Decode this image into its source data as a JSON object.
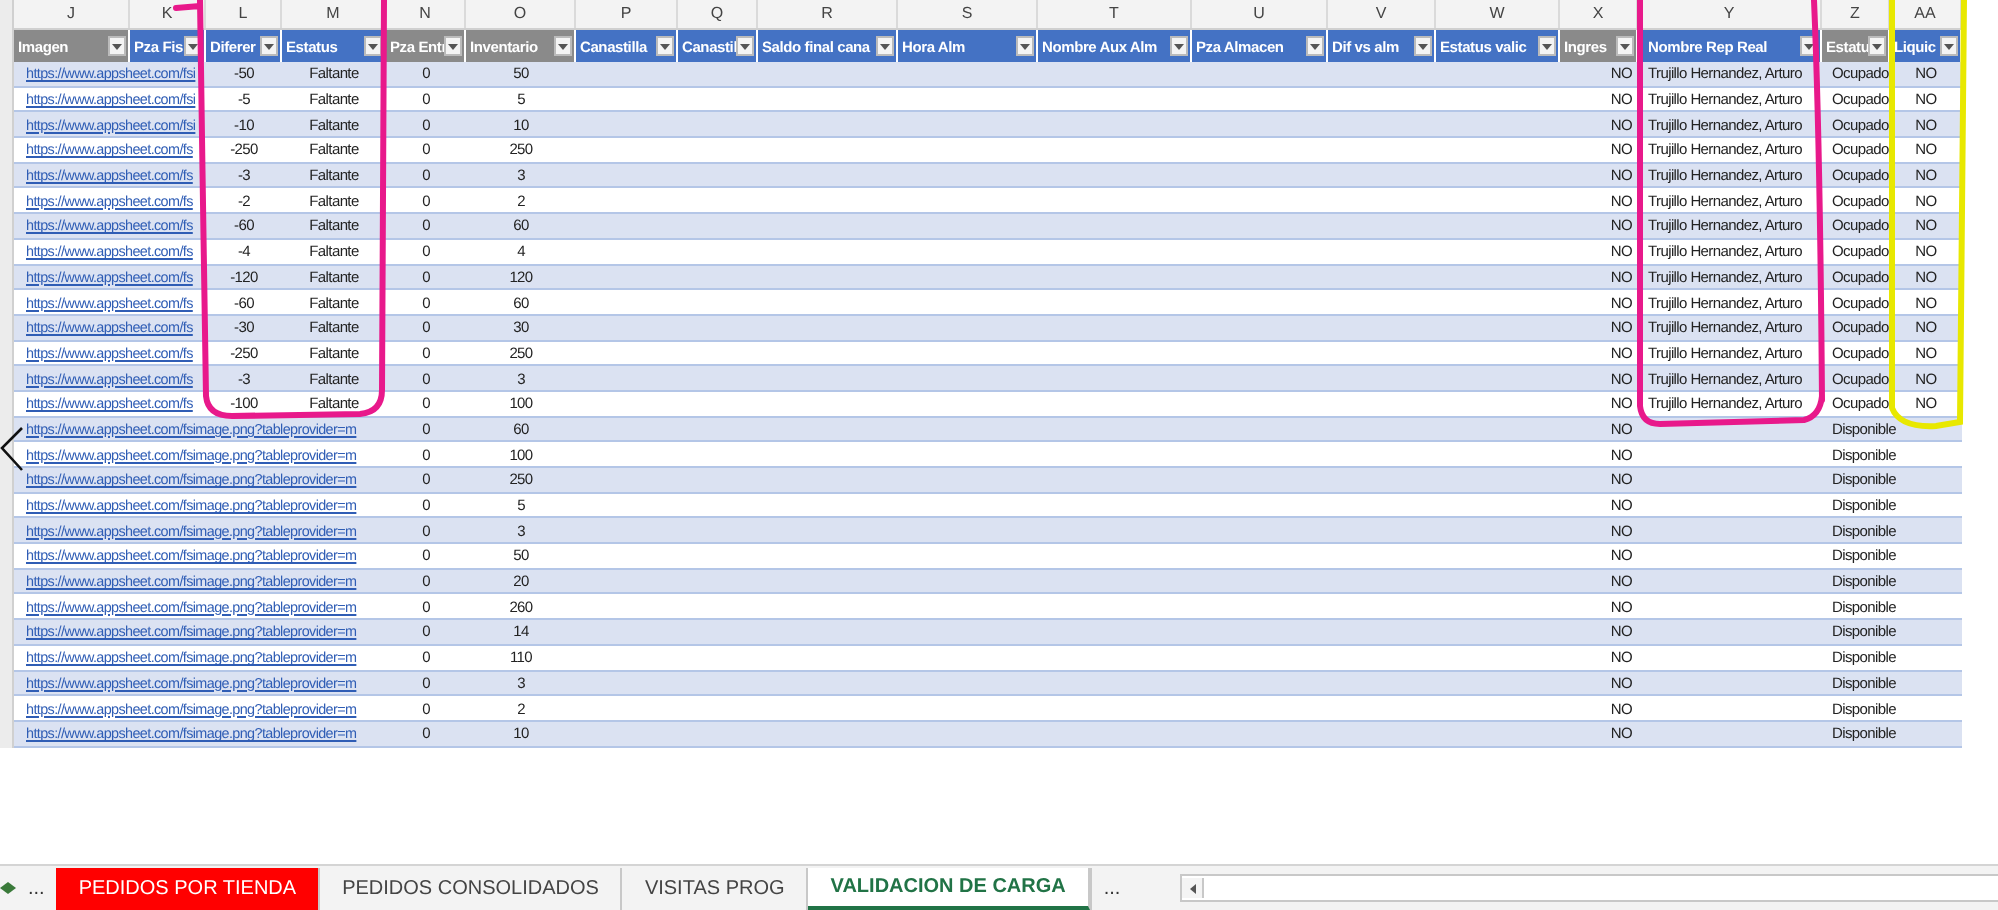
{
  "columns": [
    {
      "letter": "J",
      "header": "Imagen",
      "shaded": true,
      "kind": "link"
    },
    {
      "letter": "K",
      "header": "Pza Fis",
      "shaded": false
    },
    {
      "letter": "L",
      "header": "Diferer",
      "shaded": false,
      "kind": "centered"
    },
    {
      "letter": "M",
      "header": "Estatus",
      "shaded": false,
      "kind": "centered"
    },
    {
      "letter": "N",
      "header": "Pza Entr",
      "shaded": true,
      "kind": "centered"
    },
    {
      "letter": "O",
      "header": "Inventario",
      "shaded": true,
      "kind": "centered"
    },
    {
      "letter": "P",
      "header": "Canastilla",
      "shaded": false
    },
    {
      "letter": "Q",
      "header": "Canastil",
      "shaded": false
    },
    {
      "letter": "R",
      "header": "Saldo final cana",
      "shaded": false
    },
    {
      "letter": "S",
      "header": "Hora Alm",
      "shaded": false
    },
    {
      "letter": "T",
      "header": "Nombre Aux Alm",
      "shaded": false
    },
    {
      "letter": "U",
      "header": "Pza Almacen",
      "shaded": false
    },
    {
      "letter": "V",
      "header": "Dif vs alm",
      "shaded": false
    },
    {
      "letter": "W",
      "header": "Estatus valic",
      "shaded": false
    },
    {
      "letter": "X",
      "header": "Ingres",
      "shaded": true,
      "kind": "right"
    },
    {
      "letter": "Y",
      "header": "Nombre Rep Real",
      "shaded": false,
      "kind": "left"
    },
    {
      "letter": "Z",
      "header": "Estatu",
      "shaded": true,
      "kind": "left"
    },
    {
      "letter": "AA",
      "header": "Liquic",
      "shaded": false,
      "kind": "centered"
    }
  ],
  "rows": [
    {
      "j": "https://www.appsheet.com/fsi",
      "l": "-50",
      "m": "Faltante",
      "n": "0",
      "o": "50",
      "x": "NO",
      "y": "Trujillo Hernandez, Arturo",
      "z": "Ocupado",
      "aa": "NO"
    },
    {
      "j": "https://www.appsheet.com/fsi",
      "l": "-5",
      "m": "Faltante",
      "n": "0",
      "o": "5",
      "x": "NO",
      "y": "Trujillo Hernandez, Arturo",
      "z": "Ocupado",
      "aa": "NO"
    },
    {
      "j": "https://www.appsheet.com/fsi",
      "l": "-10",
      "m": "Faltante",
      "n": "0",
      "o": "10",
      "x": "NO",
      "y": "Trujillo Hernandez, Arturo",
      "z": "Ocupado",
      "aa": "NO"
    },
    {
      "j": "https://www.appsheet.com/fs",
      "l": "-250",
      "m": "Faltante",
      "n": "0",
      "o": "250",
      "x": "NO",
      "y": "Trujillo Hernandez, Arturo",
      "z": "Ocupado",
      "aa": "NO"
    },
    {
      "j": "https://www.appsheet.com/fs",
      "l": "-3",
      "m": "Faltante",
      "n": "0",
      "o": "3",
      "x": "NO",
      "y": "Trujillo Hernandez, Arturo",
      "z": "Ocupado",
      "aa": "NO"
    },
    {
      "j": "https://www.appsheet.com/fs",
      "l": "-2",
      "m": "Faltante",
      "n": "0",
      "o": "2",
      "x": "NO",
      "y": "Trujillo Hernandez, Arturo",
      "z": "Ocupado",
      "aa": "NO"
    },
    {
      "j": "https://www.appsheet.com/fs",
      "l": "-60",
      "m": "Faltante",
      "n": "0",
      "o": "60",
      "x": "NO",
      "y": "Trujillo Hernandez, Arturo",
      "z": "Ocupado",
      "aa": "NO"
    },
    {
      "j": "https://www.appsheet.com/fs",
      "l": "-4",
      "m": "Faltante",
      "n": "0",
      "o": "4",
      "x": "NO",
      "y": "Trujillo Hernandez, Arturo",
      "z": "Ocupado",
      "aa": "NO"
    },
    {
      "j": "https://www.appsheet.com/fs",
      "l": "-120",
      "m": "Faltante",
      "n": "0",
      "o": "120",
      "x": "NO",
      "y": "Trujillo Hernandez, Arturo",
      "z": "Ocupado",
      "aa": "NO"
    },
    {
      "j": "https://www.appsheet.com/fs",
      "l": "-60",
      "m": "Faltante",
      "n": "0",
      "o": "60",
      "x": "NO",
      "y": "Trujillo Hernandez, Arturo",
      "z": "Ocupado",
      "aa": "NO"
    },
    {
      "j": "https://www.appsheet.com/fs",
      "l": "-30",
      "m": "Faltante",
      "n": "0",
      "o": "30",
      "x": "NO",
      "y": "Trujillo Hernandez, Arturo",
      "z": "Ocupado",
      "aa": "NO"
    },
    {
      "j": "https://www.appsheet.com/fs",
      "l": "-250",
      "m": "Faltante",
      "n": "0",
      "o": "250",
      "x": "NO",
      "y": "Trujillo Hernandez, Arturo",
      "z": "Ocupado",
      "aa": "NO"
    },
    {
      "j": "https://www.appsheet.com/fs",
      "l": "-3",
      "m": "Faltante",
      "n": "0",
      "o": "3",
      "x": "NO",
      "y": "Trujillo Hernandez, Arturo",
      "z": "Ocupado",
      "aa": "NO"
    },
    {
      "j": "https://www.appsheet.com/fs",
      "l": "-100",
      "m": "Faltante",
      "n": "0",
      "o": "100",
      "x": "NO",
      "y": "Trujillo Hernandez, Arturo",
      "z": "Ocupado",
      "aa": "NO"
    },
    {
      "j": "https://www.appsheet.com/fsimage.png?tableprovider=m",
      "n": "0",
      "o": "60",
      "x": "NO",
      "z": "Disponible"
    },
    {
      "j": "https://www.appsheet.com/fsimage.png?tableprovider=m",
      "n": "0",
      "o": "100",
      "x": "NO",
      "z": "Disponible"
    },
    {
      "j": "https://www.appsheet.com/fsimage.png?tableprovider=m",
      "n": "0",
      "o": "250",
      "x": "NO",
      "z": "Disponible"
    },
    {
      "j": "https://www.appsheet.com/fsimage.png?tableprovider=m",
      "n": "0",
      "o": "5",
      "x": "NO",
      "z": "Disponible"
    },
    {
      "j": "https://www.appsheet.com/fsimage.png?tableprovider=m",
      "n": "0",
      "o": "3",
      "x": "NO",
      "z": "Disponible"
    },
    {
      "j": "https://www.appsheet.com/fsimage.png?tableprovider=m",
      "n": "0",
      "o": "50",
      "x": "NO",
      "z": "Disponible"
    },
    {
      "j": "https://www.appsheet.com/fsimage.png?tableprovider=m",
      "n": "0",
      "o": "20",
      "x": "NO",
      "z": "Disponible"
    },
    {
      "j": "https://www.appsheet.com/fsimage.png?tableprovider=m",
      "n": "0",
      "o": "260",
      "x": "NO",
      "z": "Disponible"
    },
    {
      "j": "https://www.appsheet.com/fsimage.png?tableprovider=m",
      "n": "0",
      "o": "14",
      "x": "NO",
      "z": "Disponible"
    },
    {
      "j": "https://www.appsheet.com/fsimage.png?tableprovider=m",
      "n": "0",
      "o": "110",
      "x": "NO",
      "z": "Disponible"
    },
    {
      "j": "https://www.appsheet.com/fsimage.png?tableprovider=m",
      "n": "0",
      "o": "3",
      "x": "NO",
      "z": "Disponible"
    },
    {
      "j": "https://www.appsheet.com/fsimage.png?tableprovider=m",
      "n": "0",
      "o": "2",
      "x": "NO",
      "z": "Disponible"
    },
    {
      "j": "https://www.appsheet.com/fsimage.png?tableprovider=m",
      "n": "0",
      "o": "10",
      "x": "NO",
      "z": "Disponible"
    }
  ],
  "sheet_tabs": {
    "overflow_left": "...",
    "overflow_right": "...",
    "tabs": [
      {
        "label": "PEDIDOS POR TIENDA",
        "selected": false,
        "color": "#ff0000"
      },
      {
        "label": "PEDIDOS CONSOLIDADOS",
        "selected": false
      },
      {
        "label": "VISITAS PROG",
        "selected": false
      },
      {
        "label": "VALIDACION DE CARGA",
        "selected": true
      }
    ]
  }
}
